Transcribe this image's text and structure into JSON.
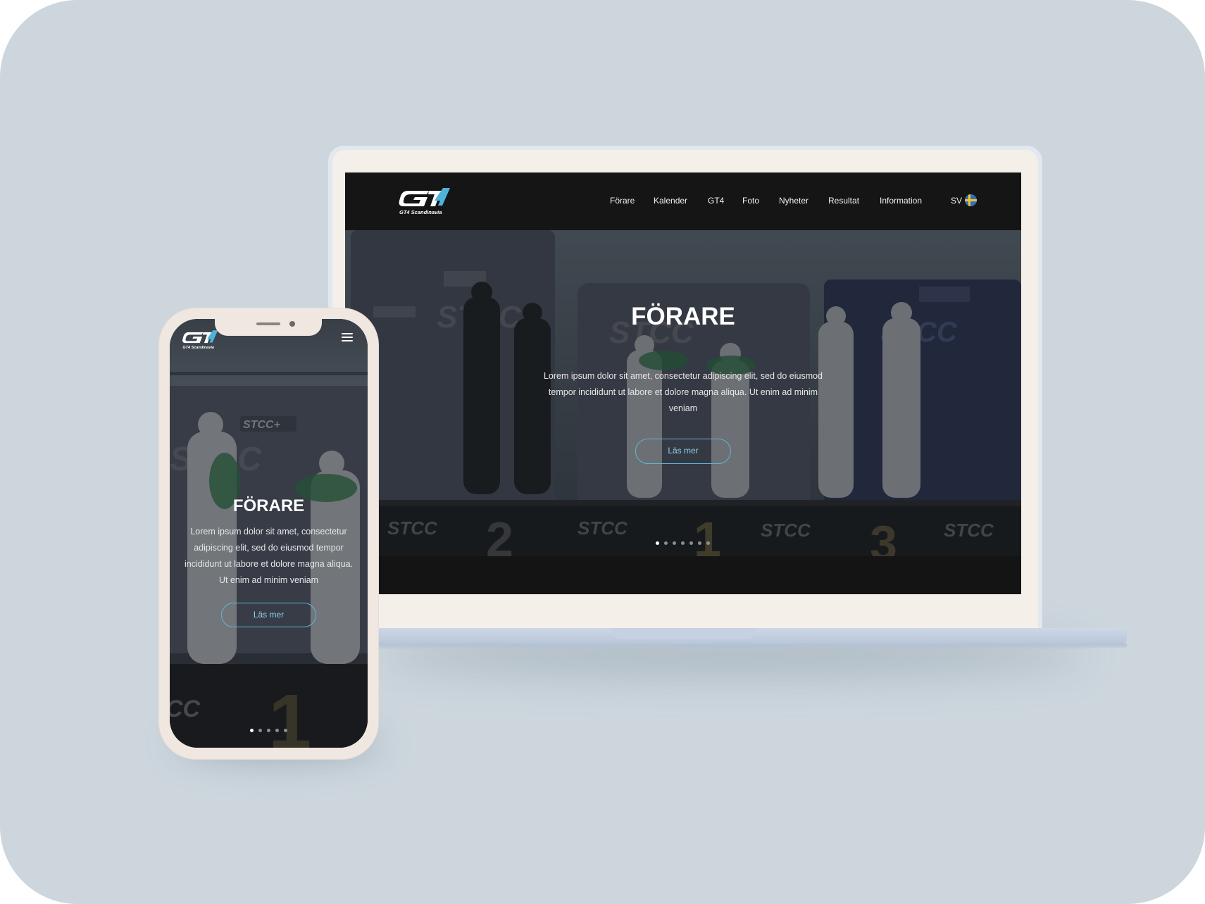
{
  "desktop": {
    "logo": {
      "mark": "GT4",
      "subtitle": "GT4 Scandinavia"
    },
    "nav": {
      "items": [
        "Förare",
        "Kalender",
        "GT4",
        "Foto",
        "Nyheter",
        "Resultat",
        "Information"
      ],
      "language": "SV",
      "flag_icon": "sweden-flag-icon"
    },
    "hero": {
      "title": "FÖRARE",
      "text": "Lorem ipsum dolor sit amet, consectetur adipiscing elit, sed do eiusmod tempor incididunt ut labore et dolore magna aliqua. Ut enim ad minim veniam",
      "button": "Läs mer",
      "slides": 7,
      "active_slide": 1
    }
  },
  "mobile": {
    "logo": {
      "mark": "GT4",
      "subtitle": "GT4 Scandinavia"
    },
    "menu_icon": "hamburger-menu-icon",
    "hero": {
      "title": "FÖRARE",
      "text": "Lorem ipsum dolor sit amet, consectetur adipiscing elit, sed do eiusmod tempor incididunt ut labore et dolore magna aliqua. Ut enim ad minim veniam",
      "button": "Läs mer",
      "slides": 5,
      "active_slide": 1
    }
  },
  "colors": {
    "background": "#cdd6dd",
    "nav_background": "#151515",
    "accent": "#5fb8d6",
    "device_frame": "#f1e7e1"
  }
}
